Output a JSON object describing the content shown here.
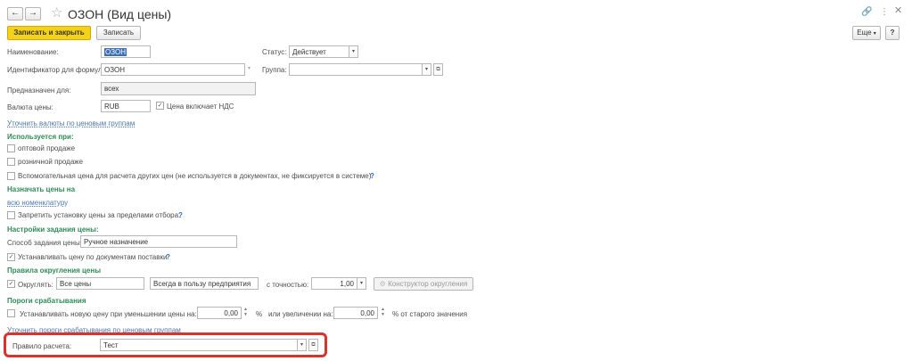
{
  "window": {
    "title": "ОЗОН (Вид цены)",
    "back_icon": "arrow-left-icon",
    "forward_icon": "arrow-right-icon",
    "star_icon": "star-icon",
    "link_icon": "link-icon",
    "menu_icon": "kebab-icon",
    "close_icon": "close-icon"
  },
  "toolbar": {
    "save_close_label": "Записать и закрыть",
    "save_label": "Записать",
    "more_label": "Еще",
    "more_arrow": "▾",
    "help_label": "?"
  },
  "form": {
    "name_label": "Наименование:",
    "name_value": "ОЗОН",
    "status_label": "Статус:",
    "status_value": "Действует",
    "formula_id_label": "Идентификатор для формул:",
    "formula_id_value": "ОЗОН",
    "group_label": "Группа:",
    "group_value": "",
    "intended_label": "Предназначен для:",
    "intended_value": "всех",
    "currency_label": "Валюта цены:",
    "currency_value": "RUB",
    "vat_label": "Цена включает НДС",
    "currency_link": "Уточнить валюты по ценовым группам"
  },
  "usage": {
    "header": "Используется при:",
    "wholesale": "оптовой продаже",
    "retail": "розничной продаже",
    "auxiliary": "Вспомогательная цена для расчета других цен (не используется в документах, не фиксируется в системе).",
    "help": "?"
  },
  "assign": {
    "header": "Назначать цены на",
    "link": "всю номенклатуру",
    "forbid": "Запретить установку цены за пределами отбора.",
    "help": "?"
  },
  "settings": {
    "header": "Настройки задания цены:",
    "method_label": "Способ задания цены:",
    "method_value": "Ручное назначение",
    "supply_docs": "Устанавливать цену по документам поставки",
    "help": "?"
  },
  "rounding": {
    "header": "Правила округления цены",
    "round_label": "Округлять:",
    "all_prices": "Все цены",
    "direction": "Всегда в пользу предприятия",
    "precision_label": "с точностью:",
    "precision_value": "1,00",
    "constructor_label": "Конструктор округления"
  },
  "thresholds": {
    "header": "Пороги срабатывания",
    "decrease_label": "Устанавливать новую цену при уменьшении цены на:",
    "decrease_value": "0,00",
    "percent_sign": "%",
    "increase_label": "или увеличении на:",
    "increase_value": "0,00",
    "old_value_label": "% от старого значения",
    "link": "Уточнить пороги срабатывания по ценовым группам"
  },
  "calc_rule": {
    "label": "Правило расчета:",
    "value": "Тест"
  },
  "colors": {
    "primary_button": "#f5d21a",
    "section_header": "#2e8b57",
    "link": "#4b78b0",
    "highlight_border": "#d8342c"
  }
}
